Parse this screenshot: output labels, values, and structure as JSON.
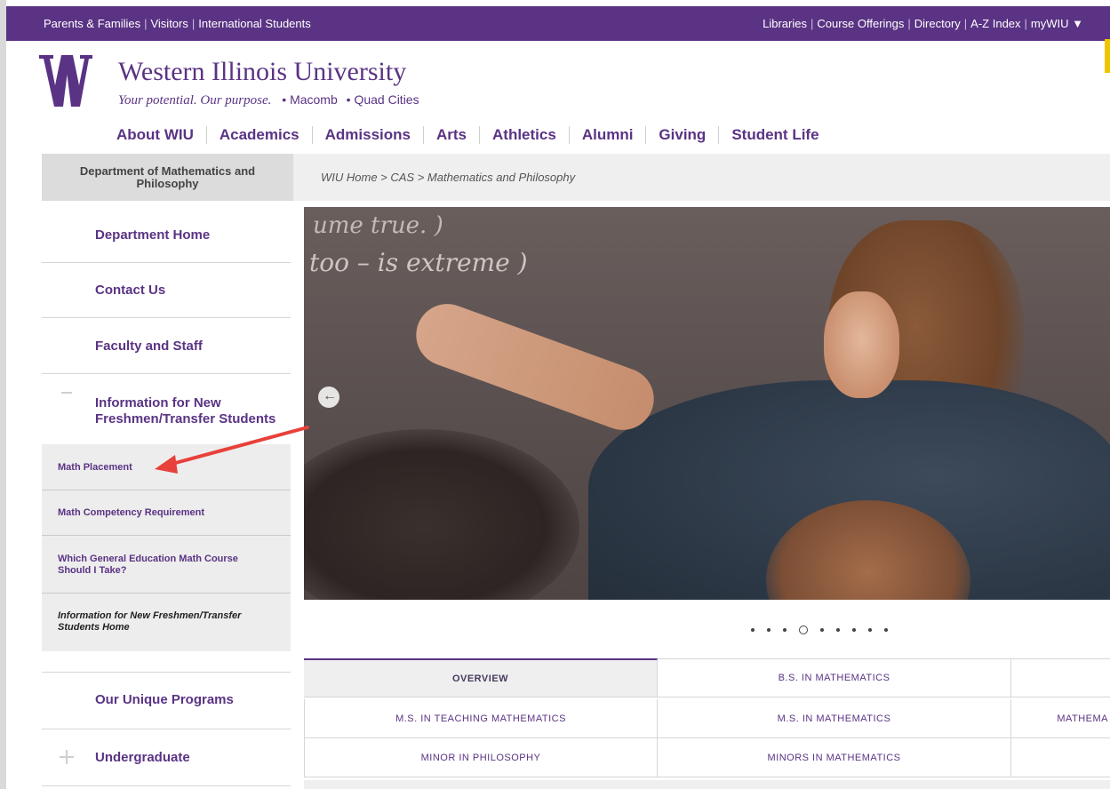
{
  "topbar": {
    "left_links": [
      "Parents & Families",
      "Visitors",
      "International Students"
    ],
    "right_links": [
      "Libraries",
      "Course Offerings",
      "Directory",
      "A-Z Index"
    ],
    "mywiu_label": "myWIU ▼"
  },
  "brand": {
    "name": "Western Illinois University",
    "tagline": "Your potential. Our purpose.",
    "campus_1": "• Macomb",
    "campus_2": "• Quad Cities",
    "color": "#5a3384"
  },
  "mainnav": {
    "items": [
      "About WIU",
      "Academics",
      "Admissions",
      "Arts",
      "Athletics",
      "Alumni",
      "Giving",
      "Student Life"
    ]
  },
  "department": {
    "title": "Department of Mathematics and Philosophy"
  },
  "breadcrumb": {
    "text": "WIU Home > CAS > Mathematics and Philosophy"
  },
  "sidenav": {
    "items": [
      {
        "label": "Department Home"
      },
      {
        "label": "Contact Us"
      },
      {
        "label": "Faculty and Staff"
      },
      {
        "label": "Information for New Freshmen/Transfer Students",
        "line1": "Information for New",
        "line2": "Freshmen/Transfer Students"
      },
      {
        "label": "Our Unique Programs"
      },
      {
        "label": "Undergraduate"
      }
    ],
    "subitems": [
      {
        "label": "Math Placement"
      },
      {
        "label": "Math Competency Requirement"
      },
      {
        "label": "Which General Education Math Course Should I Take?"
      },
      {
        "label": "Information for New Freshmen/Transfer Students Home"
      }
    ]
  },
  "slider": {
    "chalk_line_1": "ume true. )",
    "chalk_line_2": "too – is extreme )",
    "active_dot": 4,
    "dot_count": 9
  },
  "program_tabs": {
    "row1": [
      "OVERVIEW",
      "B.S. IN MATHEMATICS",
      ""
    ],
    "row2": [
      "M.S. IN TEACHING MATHEMATICS",
      "M.S. IN MATHEMATICS",
      "MATHEMA"
    ],
    "row3": [
      "MINOR IN PHILOSOPHY",
      "MINORS IN MATHEMATICS",
      ""
    ]
  }
}
